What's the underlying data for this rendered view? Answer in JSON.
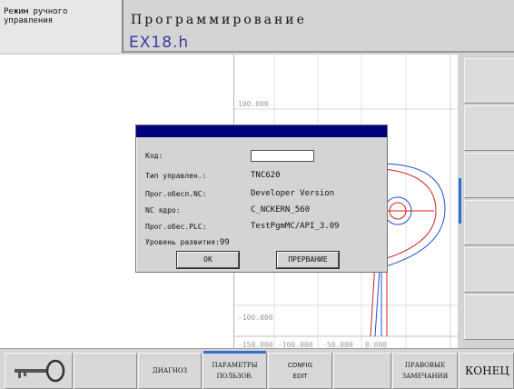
{
  "header": {
    "mode_line1": "Режим ручного",
    "mode_line2": "управления",
    "title": "Программирование",
    "file": "EX18.h"
  },
  "graphic": {
    "y_labels": [
      "100.000",
      "-100.000"
    ],
    "x_labels": [
      "-150.000",
      "-100.000",
      "-50.000",
      "0.000"
    ],
    "line_colors": {
      "blue": "#2050d0",
      "red": "#d02020"
    }
  },
  "dialog": {
    "code_label": "Код:",
    "code_value": "",
    "rows": [
      {
        "label": "Тип управлен.:",
        "value": "TNC620"
      },
      {
        "label": "Прог.обесп.NC:",
        "value": "Developer Version"
      },
      {
        "label": "NC ядро:",
        "value": "C_NCKERN_560"
      },
      {
        "label": "Прог.обес.PLC:",
        "value": "TestPgmMC/API_3.09"
      }
    ],
    "level_label": "Уровень развития:",
    "level_value": "99",
    "ok_label": "OK",
    "cancel_label": "ПРЕРВАНИЕ"
  },
  "softkeys": {
    "key_icon": "key-icon",
    "diagnosis": "ДИАГНОЗ",
    "user_params_line1": "ПАРАМЕТРЫ",
    "user_params_line2": "ПОЛЬЗОВ.",
    "config_line1": "CONFIG",
    "config_line2": "EDIT",
    "legal_line1": "ПРАВОВЫЕ",
    "legal_line2": "ЗАМЕЧАНИЯ",
    "end": "КОНЕЦ"
  }
}
